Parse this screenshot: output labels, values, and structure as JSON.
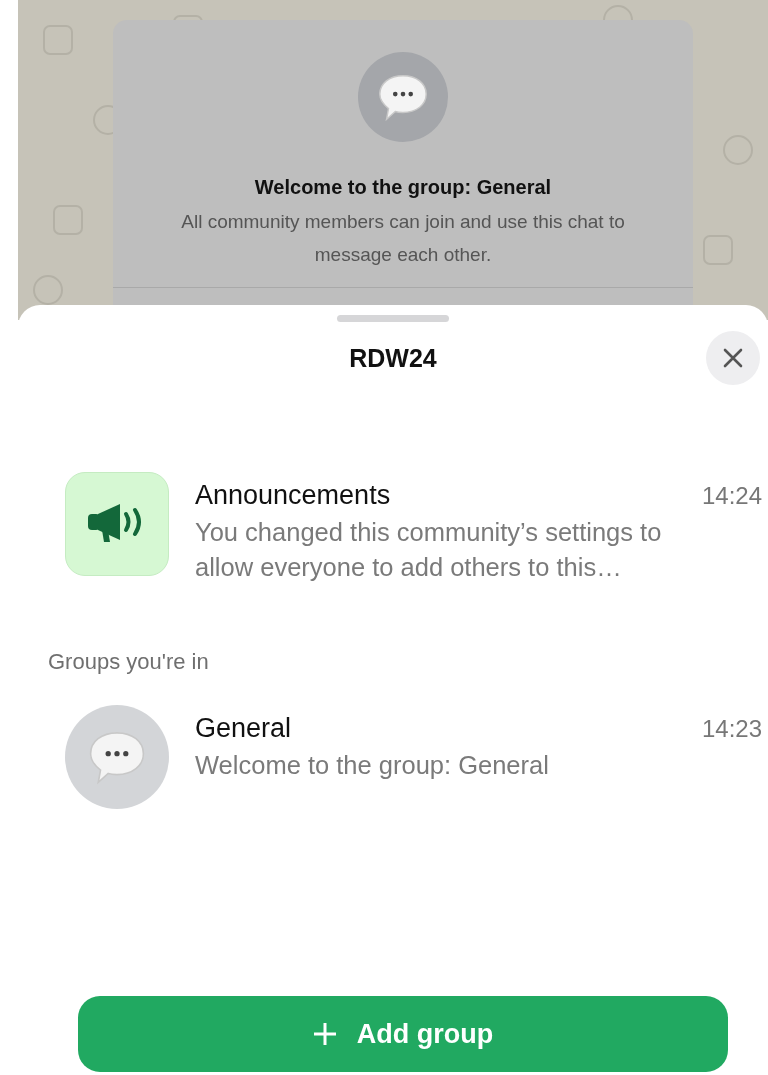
{
  "chat_preview": {
    "title": "Welcome to the group: General",
    "description": "All community members can join and use this chat to message each other."
  },
  "sheet": {
    "title": "RDW24"
  },
  "announcement": {
    "name": "Announcements",
    "time": "14:24",
    "preview": "You changed this community’s settings to allow everyone to add others to this…"
  },
  "groups_header": "Groups you're in",
  "groups": [
    {
      "name": "General",
      "time": "14:23",
      "preview": "Welcome to the group: General"
    }
  ],
  "add_button": {
    "label": "Add group"
  }
}
